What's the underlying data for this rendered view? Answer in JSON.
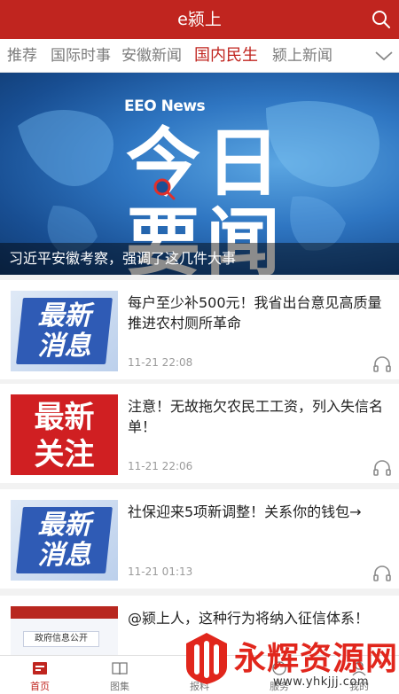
{
  "header": {
    "title": "e颍上",
    "search_icon": "search-icon"
  },
  "tabs": [
    {
      "label": "推荐",
      "active": false
    },
    {
      "label": "国际时事",
      "active": false
    },
    {
      "label": "安徽新闻",
      "active": false
    },
    {
      "label": "国内民生",
      "active": true
    },
    {
      "label": "颍上新闻",
      "active": false
    }
  ],
  "banner": {
    "ticker": "EEO News",
    "logo_line1": "今日",
    "logo_line2": "要闻",
    "caption": "习近平安徽考察，强调了这几件大事"
  },
  "news": [
    {
      "thumb_text": [
        "最新",
        "消息"
      ],
      "headline": "每户至少补500元！我省出台意见高质量推进农村厕所革命",
      "time": "11-21 22:08"
    },
    {
      "thumb_text": [
        "最新",
        "关注"
      ],
      "headline": "注意！无故拖欠农民工工资，列入失信名单！",
      "time": "11-21 22:06"
    },
    {
      "thumb_text": [
        "最新",
        "消息"
      ],
      "headline": "社保迎来5项新调整！关系你的钱包→",
      "time": "11-21 01:13"
    },
    {
      "thumb_text": [
        "政府信息公开"
      ],
      "headline": "@颍上人，这种行为将纳入征信体系！",
      "time": ""
    }
  ],
  "bottom_nav": [
    {
      "label": "首页",
      "icon": "home-icon",
      "active": true
    },
    {
      "label": "图集",
      "icon": "book-icon",
      "active": false
    },
    {
      "label": "报料",
      "icon": "report-icon",
      "active": false
    },
    {
      "label": "服务",
      "icon": "service-icon",
      "active": false
    },
    {
      "label": "我的",
      "icon": "user-icon",
      "active": false
    }
  ],
  "watermark": {
    "text": "永辉资源网",
    "url": "www.yhkjjj.com"
  },
  "colors": {
    "brand": "#c0251f",
    "watermark": "#e1261c"
  }
}
